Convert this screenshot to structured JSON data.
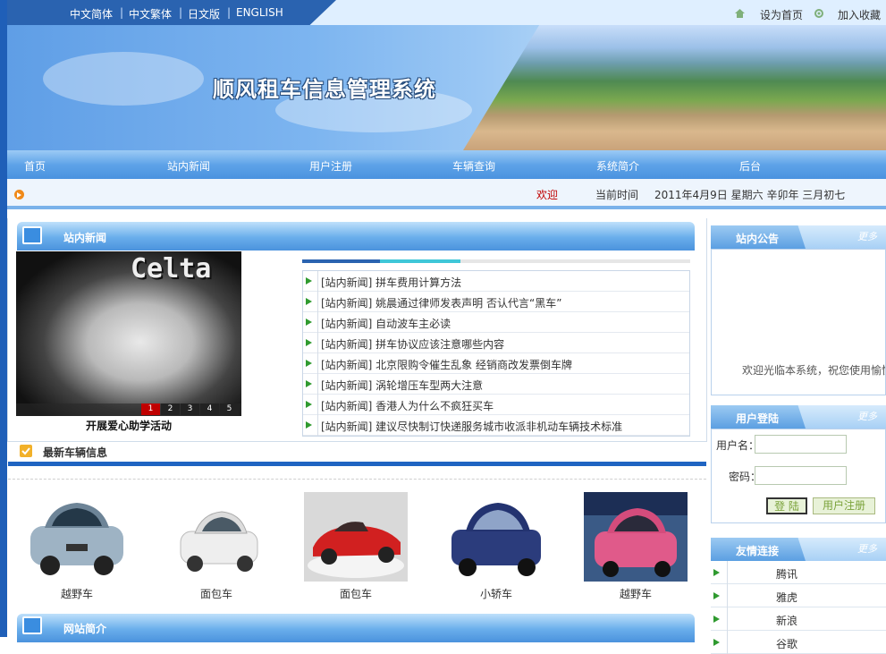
{
  "top": {
    "languages": [
      "中文简体",
      "中文繁体",
      "日文版",
      "ENGLISH"
    ],
    "separator": "|",
    "set_home": "设为首页",
    "add_favorite": "加入收藏"
  },
  "banner": {
    "title": "顺风租车信息管理系统"
  },
  "nav": [
    "首页",
    "站内新闻",
    "用户注册",
    "车辆查询",
    "系统简介",
    "后台"
  ],
  "datebar": {
    "welcome": "欢迎",
    "time_label": "当前时间",
    "date_text": "2011年4月9日 星期六 辛卯年 三月初七"
  },
  "news": {
    "title": "站内新闻",
    "slideshow_caption": "开展爱心助学活动",
    "slide_numbers": [
      "1",
      "2",
      "3",
      "4",
      "5"
    ],
    "image_text": "Celta",
    "items": [
      "[站内新闻] 拼车费用计算方法",
      "[站内新闻] 姚晨通过律师发表声明 否认代言“黑车”",
      "[站内新闻] 自动波车主必读",
      "[站内新闻] 拼车协议应该注意哪些内容",
      "[站内新闻] 北京限购令催生乱象 经销商改发票倒车牌",
      "[站内新闻] 涡轮增压车型两大注意",
      "[站内新闻] 香港人为什么不疯狂买车",
      "[站内新闻] 建议尽快制订快递服务城市收派非机动车辆技术标准"
    ]
  },
  "latest_cars": {
    "title": "最新车辆信息",
    "cars": [
      {
        "label": "越野车"
      },
      {
        "label": "面包车"
      },
      {
        "label": "面包车"
      },
      {
        "label": "小轿车"
      },
      {
        "label": "越野车"
      }
    ]
  },
  "intro": {
    "title": "网站简介"
  },
  "notice": {
    "title": "站内公告",
    "more": "更多",
    "marquee": "欢迎光临本系统，祝您使用愉快"
  },
  "login": {
    "title": "用户登陆",
    "more": "更多",
    "username_label": "用户名：",
    "password_label": "密码：",
    "login_button": "登 陆",
    "register_button": "用户注册"
  },
  "links": {
    "title": "友情连接",
    "more": "更多",
    "items": [
      "腾讯",
      "雅虎",
      "新浪",
      "谷歌"
    ]
  },
  "colors": {
    "brand_blue": "#2a63b0",
    "nav_blue": "#4a92df",
    "accent_red": "#c00000"
  }
}
